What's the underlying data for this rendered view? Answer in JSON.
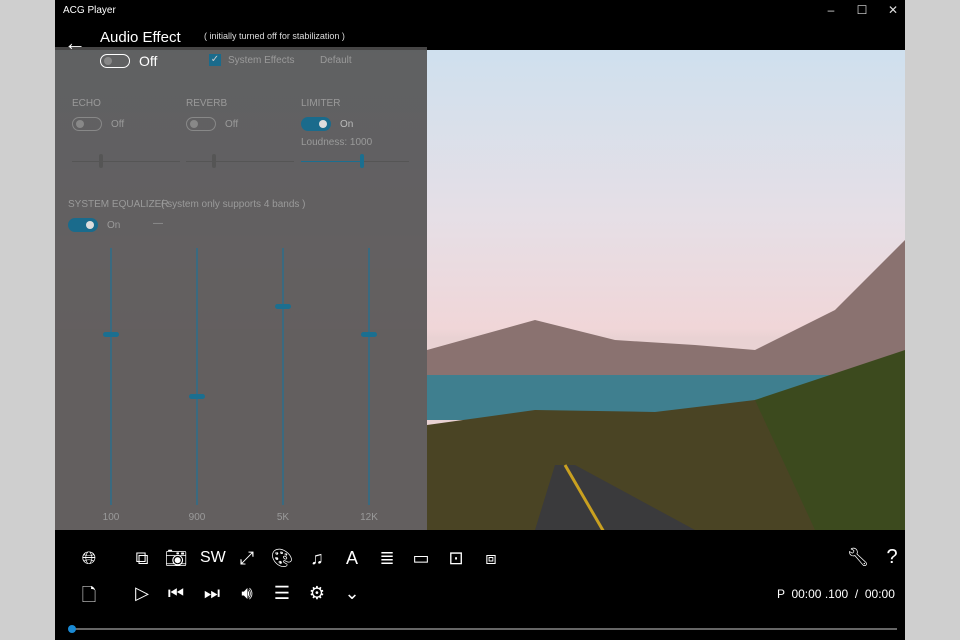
{
  "window": {
    "title": "ACG Player"
  },
  "panel": {
    "title": "Audio Effect",
    "note": "( initially turned off for stabilization )",
    "master": {
      "state": "Off"
    },
    "system_effects": {
      "label": "System Effects",
      "checked": true
    },
    "default_label": "Default",
    "echo": {
      "label": "ECHO",
      "state": "Off",
      "level": 0.25
    },
    "reverb": {
      "label": "REVERB",
      "state": "Off",
      "level": 0.24
    },
    "limiter": {
      "label": "LIMITER",
      "state": "On",
      "loudness_label": "Loudness: 1000",
      "level": 0.55
    },
    "equalizer": {
      "label": "SYSTEM EQUALIZER",
      "note": "( system only supports 4 bands )",
      "state": "On",
      "dash": "—",
      "bands": [
        {
          "label": "100",
          "level": 0.665
        },
        {
          "label": "900",
          "level": 0.424
        },
        {
          "label": "5K",
          "level": 0.774
        },
        {
          "label": "12K",
          "level": 0.665
        }
      ]
    }
  },
  "toolbar": {
    "sw_label": "SW",
    "help": "?"
  },
  "time": {
    "display": "P  00:00 .100  /  00:00"
  },
  "progress": 0.0
}
